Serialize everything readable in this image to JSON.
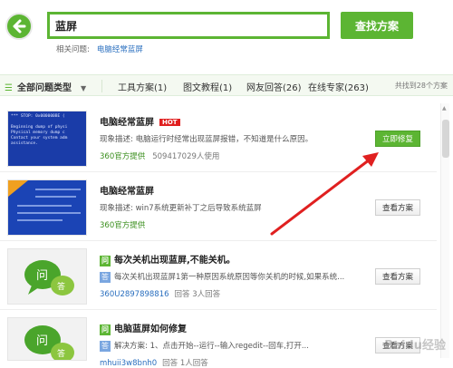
{
  "search": {
    "query": "蓝屏",
    "button_label": "查找方案",
    "related_label": "相关问题:",
    "related_link": "电脑经常蓝屏"
  },
  "tabs": {
    "all_label": "全部问题类型",
    "tools": "工具方案(1)",
    "tutorials": "图文教程(1)",
    "answers": "网友回答(26)",
    "experts": "在线专家(263)",
    "total": "共找到28个方案"
  },
  "items": [
    {
      "title": "电脑经常蓝屏",
      "hot": "HOT",
      "desc": "现象描述: 电脑运行时经常出现蓝屏报错，不知道是什么原因。",
      "source": "360官方提供",
      "meta": "509417029人使用",
      "action": "立即修复"
    },
    {
      "title": "电脑经常蓝屏",
      "desc": "现象描述: win7系统更新补丁之后导致系统蓝屏",
      "source": "360官方提供",
      "action": "查看方案"
    },
    {
      "q": "问",
      "title": "每次关机出现蓝屏,不能关机。",
      "a": "答",
      "desc": "每次关机出现蓝屏1第一种原因系统原因等你关机的时候,如果系统...",
      "user": "360U2897898816",
      "meta": "回答   3人回答",
      "action": "查看方案"
    },
    {
      "q": "问",
      "title": "电脑蓝屏如何修复",
      "a": "答",
      "desc": "解决方案:   1、点击开始--运行--输入regedit--回车,打开...",
      "user": "mhuii3w8bnh0",
      "meta": "回答   1人回答",
      "action": "查看方案"
    }
  ],
  "bsod_text": "*** STOP: 0x000000BE (\n\nBeginning dump of physi\nPhysical memory dump c\nContact your system adm\nassistance.",
  "watermark": "Baidu经验",
  "colors": {
    "accent": "#5cb533",
    "link": "#2a6fbf",
    "annotation": "#e02020"
  }
}
